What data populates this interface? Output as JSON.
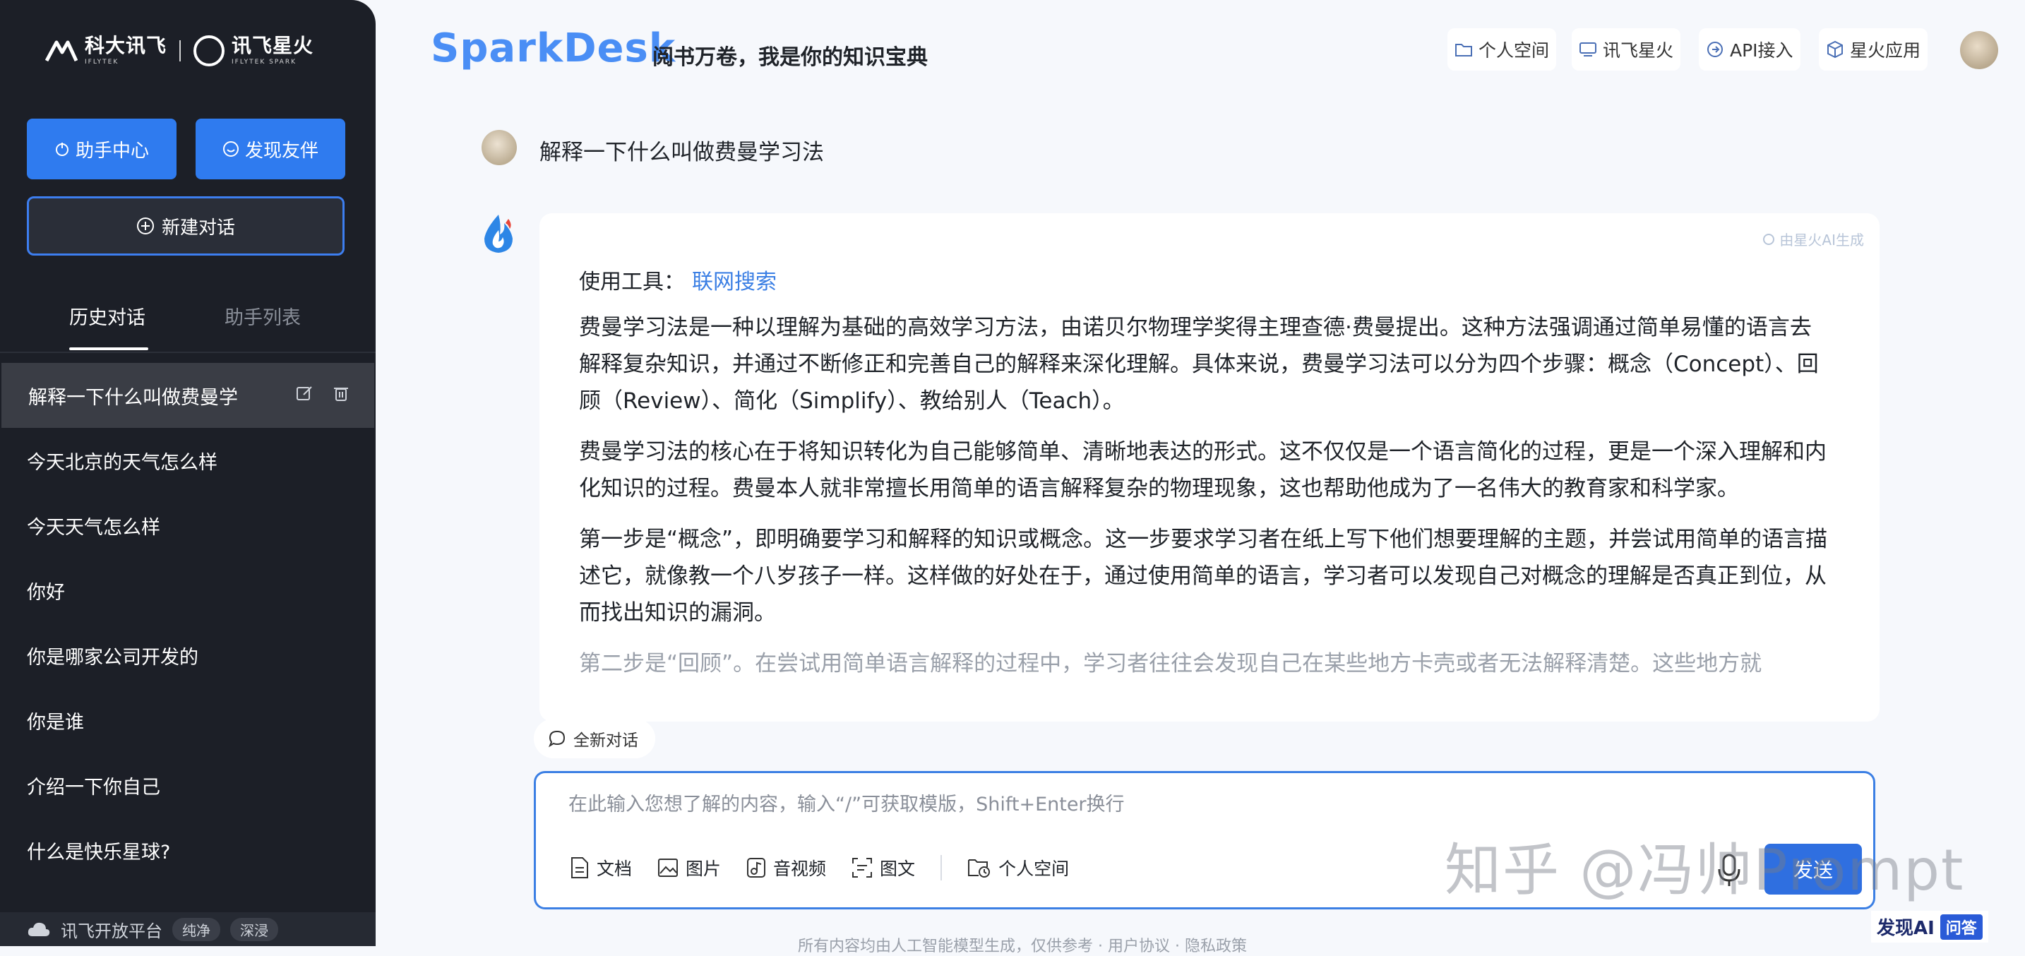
{
  "sidebar": {
    "logo_left": "科大讯飞",
    "logo_left_sub": "IFLYTEK",
    "logo_right": "讯飞星火",
    "logo_right_sub": "IFLYTEK SPARK",
    "assistant_center": "助手中心",
    "discover_partners": "发现友伴",
    "new_chat": "新建对话",
    "tabs": [
      "历史对话",
      "助手列表"
    ],
    "history": [
      "解释一下什么叫做费曼学",
      "今天北京的天气怎么样",
      "今天天气怎么样",
      "你好",
      "你是哪家公司开发的",
      "你是谁",
      "介绍一下你自己",
      "什么是快乐星球?"
    ],
    "footer_platform": "讯飞开放平台",
    "footer_pills": [
      "纯净",
      "深浸"
    ]
  },
  "header": {
    "brand": "SparkDesk",
    "slogan": "阅书万卷，我是你的知识宝典",
    "nav": [
      "个人空间",
      "讯飞星火",
      "API接入",
      "星火应用"
    ]
  },
  "chat": {
    "question": "解释一下什么叫做费曼学习法",
    "ai_tag": "由星火AI生成",
    "tool_label": "使用工具：",
    "tool_name": "联网搜索",
    "paragraphs": [
      "费曼学习法是一种以理解为基础的高效学习方法，由诺贝尔物理学奖得主理查德·费曼提出。这种方法强调通过简单易懂的语言去解释复杂知识，并通过不断修正和完善自己的解释来深化理解。具体来说，费曼学习法可以分为四个步骤：概念（Concept）、回顾（Review）、简化（Simplify）、教给别人（Teach）。",
      "费曼学习法的核心在于将知识转化为自己能够简单、清晰地表达的形式。这不仅仅是一个语言简化的过程，更是一个深入理解和内化知识的过程。费曼本人就非常擅长用简单的语言解释复杂的物理现象，这也帮助他成为了一名伟大的教育家和科学家。",
      "第一步是“概念”，即明确要学习和解释的知识或概念。这一步要求学习者在纸上写下他们想要理解的主题，并尝试用简单的语言描述它，就像教一个八岁孩子一样。这样做的好处在于，通过使用简单的语言，学习者可以发现自己对概念的理解是否真正到位，从而找出知识的漏洞。",
      "第二步是“回顾”。在尝试用简单语言解释的过程中，学习者往往会发现自己在某些地方卡壳或者无法解释清楚。这些地方就"
    ],
    "new_chat_pill": "全新对话"
  },
  "input": {
    "placeholder": "在此输入您想了解的内容，输入“/”可获取模版，Shift+Enter换行",
    "tools": [
      "文档",
      "图片",
      "音视频",
      "图文",
      "个人空间"
    ],
    "send": "发送"
  },
  "footer_note": "所有内容均由人工智能模型生成，仅供参考 · 用户协议 · 隐私政策",
  "watermark": "知乎 @冯帅Prompt",
  "corner_badge": {
    "brand": "发现AI",
    "tag": "问答"
  },
  "colors": {
    "accent": "#2f7bef",
    "sidebar_bg": "#1c1f27",
    "page_bg": "#f6f8fc",
    "brand": "#4a8ef5"
  }
}
